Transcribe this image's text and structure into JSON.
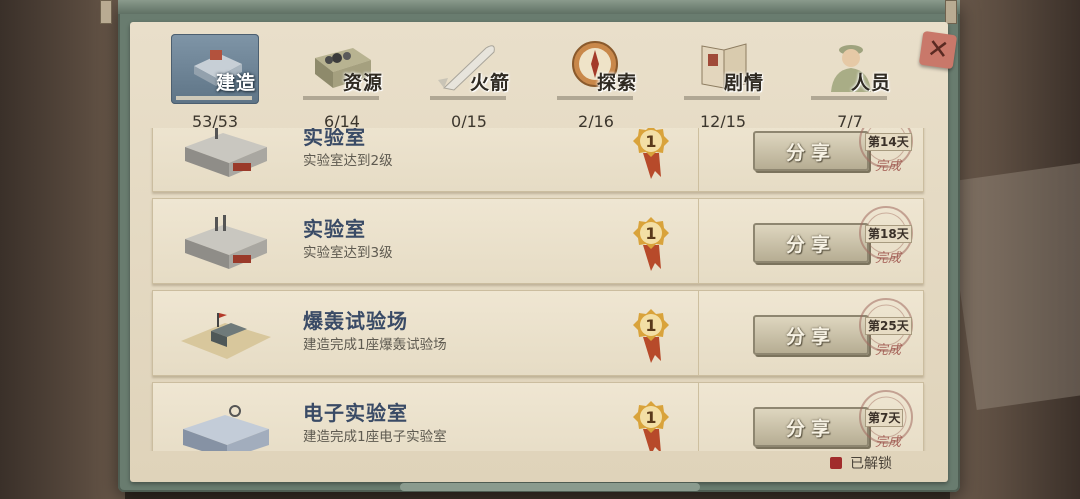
{
  "tabs": [
    {
      "id": "build",
      "label": "建造",
      "count": "53/53",
      "active": true,
      "icon": "building-tile-icon"
    },
    {
      "id": "resource",
      "label": "资源",
      "count": "6/14",
      "active": false,
      "icon": "resource-crate-icon"
    },
    {
      "id": "rocket",
      "label": "火箭",
      "count": "0/15",
      "active": false,
      "icon": "rocket-icon"
    },
    {
      "id": "explore",
      "label": "探索",
      "count": "2/16",
      "active": false,
      "icon": "compass-icon"
    },
    {
      "id": "story",
      "label": "剧情",
      "count": "12/15",
      "active": false,
      "icon": "book-icon"
    },
    {
      "id": "staff",
      "label": "人员",
      "count": "7/7",
      "active": false,
      "icon": "person-icon"
    }
  ],
  "close_label": "✕",
  "achievements": [
    {
      "title": "实验室",
      "desc": "实验室达到2级",
      "medal": "1",
      "share": "分享",
      "day": "第14天",
      "done": "完成"
    },
    {
      "title": "实验室",
      "desc": "实验室达到3级",
      "medal": "1",
      "share": "分享",
      "day": "第18天",
      "done": "完成"
    },
    {
      "title": "爆轰试验场",
      "desc": "建造完成1座爆轰试验场",
      "medal": "1",
      "share": "分享",
      "day": "第25天",
      "done": "完成"
    },
    {
      "title": "电子实验室",
      "desc": "建造完成1座电子实验室",
      "medal": "1",
      "share": "分享",
      "day": "第7天",
      "done": "完成"
    }
  ],
  "legend": {
    "label": "已解锁",
    "color": "#a12c2c"
  }
}
